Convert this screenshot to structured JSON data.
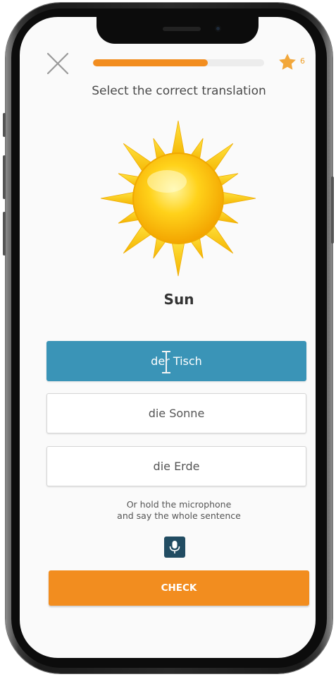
{
  "header": {
    "close_icon": "close-icon",
    "progress_percent": 0.67,
    "progress_color": "#f28d1f",
    "star_icon": "star-icon",
    "star_count": "6"
  },
  "exercise": {
    "prompt": "Select the correct translation",
    "image_icon": "sun-image",
    "word": "Sun"
  },
  "options": [
    {
      "label": "der Tisch",
      "selected": true
    },
    {
      "label": "die Sonne",
      "selected": false
    },
    {
      "label": "die Erde",
      "selected": false
    }
  ],
  "microphone": {
    "hint_line1": "Or hold the microphone",
    "hint_line2": "and say the whole sentence",
    "icon": "microphone-icon"
  },
  "actions": {
    "check_label": "CHECK"
  },
  "colors": {
    "accent_orange": "#f28d1f",
    "selected_blue": "#3a94b7",
    "mic_navy": "#214c62"
  }
}
